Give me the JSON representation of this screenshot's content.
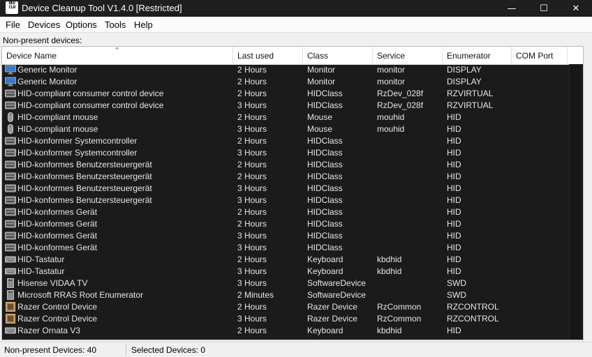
{
  "window": {
    "title": "Device Cleanup Tool V1.4.0  [Restricted]",
    "icon_text": [
      "DEV",
      "CLN"
    ],
    "minimize_glyph": "—",
    "maximize_glyph": "☐",
    "close_glyph": "✕"
  },
  "menu": [
    "File",
    "Devices",
    "Options",
    "Tools",
    "Help"
  ],
  "section_label": "Non-present devices:",
  "columns": [
    "Device Name",
    "Last used",
    "Class",
    "Service",
    "Enumerator",
    "COM Port"
  ],
  "sort_indicator": "⌃",
  "rows": [
    {
      "icon": "monitor-icon",
      "name": "Generic Monitor",
      "last_used": "2 Hours",
      "class": "Monitor",
      "service": "monitor",
      "enumerator": "DISPLAY",
      "com_port": ""
    },
    {
      "icon": "monitor-icon",
      "name": "Generic Monitor",
      "last_used": "2 Hours",
      "class": "Monitor",
      "service": "monitor",
      "enumerator": "DISPLAY",
      "com_port": ""
    },
    {
      "icon": "hid-device-icon",
      "name": "HID-compliant consumer control device",
      "last_used": "2 Hours",
      "class": "HIDClass",
      "service": "RzDev_028f",
      "enumerator": "RZVIRTUAL",
      "com_port": ""
    },
    {
      "icon": "hid-device-icon",
      "name": "HID-compliant consumer control device",
      "last_used": "3 Hours",
      "class": "HIDClass",
      "service": "RzDev_028f",
      "enumerator": "RZVIRTUAL",
      "com_port": ""
    },
    {
      "icon": "mouse-icon",
      "name": "HID-compliant mouse",
      "last_used": "2 Hours",
      "class": "Mouse",
      "service": "mouhid",
      "enumerator": "HID",
      "com_port": ""
    },
    {
      "icon": "mouse-icon",
      "name": "HID-compliant mouse",
      "last_used": "3 Hours",
      "class": "Mouse",
      "service": "mouhid",
      "enumerator": "HID",
      "com_port": ""
    },
    {
      "icon": "hid-device-icon",
      "name": "HID-konformer Systemcontroller",
      "last_used": "2 Hours",
      "class": "HIDClass",
      "service": "",
      "enumerator": "HID",
      "com_port": ""
    },
    {
      "icon": "hid-device-icon",
      "name": "HID-konformer Systemcontroller",
      "last_used": "3 Hours",
      "class": "HIDClass",
      "service": "",
      "enumerator": "HID",
      "com_port": ""
    },
    {
      "icon": "hid-device-icon",
      "name": "HID-konformes Benutzersteuergerät",
      "last_used": "2 Hours",
      "class": "HIDClass",
      "service": "",
      "enumerator": "HID",
      "com_port": ""
    },
    {
      "icon": "hid-device-icon",
      "name": "HID-konformes Benutzersteuergerät",
      "last_used": "2 Hours",
      "class": "HIDClass",
      "service": "",
      "enumerator": "HID",
      "com_port": ""
    },
    {
      "icon": "hid-device-icon",
      "name": "HID-konformes Benutzersteuergerät",
      "last_used": "3 Hours",
      "class": "HIDClass",
      "service": "",
      "enumerator": "HID",
      "com_port": ""
    },
    {
      "icon": "hid-device-icon",
      "name": "HID-konformes Benutzersteuergerät",
      "last_used": "3 Hours",
      "class": "HIDClass",
      "service": "",
      "enumerator": "HID",
      "com_port": ""
    },
    {
      "icon": "hid-device-icon",
      "name": "HID-konformes Gerät",
      "last_used": "2 Hours",
      "class": "HIDClass",
      "service": "",
      "enumerator": "HID",
      "com_port": ""
    },
    {
      "icon": "hid-device-icon",
      "name": "HID-konformes Gerät",
      "last_used": "2 Hours",
      "class": "HIDClass",
      "service": "",
      "enumerator": "HID",
      "com_port": ""
    },
    {
      "icon": "hid-device-icon",
      "name": "HID-konformes Gerät",
      "last_used": "3 Hours",
      "class": "HIDClass",
      "service": "",
      "enumerator": "HID",
      "com_port": ""
    },
    {
      "icon": "hid-device-icon",
      "name": "HID-konformes Gerät",
      "last_used": "3 Hours",
      "class": "HIDClass",
      "service": "",
      "enumerator": "HID",
      "com_port": ""
    },
    {
      "icon": "keyboard-icon",
      "name": "HID-Tastatur",
      "last_used": "2 Hours",
      "class": "Keyboard",
      "service": "kbdhid",
      "enumerator": "HID",
      "com_port": ""
    },
    {
      "icon": "keyboard-icon",
      "name": "HID-Tastatur",
      "last_used": "3 Hours",
      "class": "Keyboard",
      "service": "kbdhid",
      "enumerator": "HID",
      "com_port": ""
    },
    {
      "icon": "software-device-icon",
      "name": "Hisense VIDAA TV",
      "last_used": "3 Hours",
      "class": "SoftwareDevice",
      "service": "",
      "enumerator": "SWD",
      "com_port": ""
    },
    {
      "icon": "software-device-icon",
      "name": "Microsoft RRAS Root Enumerator",
      "last_used": "2 Minutes",
      "class": "SoftwareDevice",
      "service": "",
      "enumerator": "SWD",
      "com_port": ""
    },
    {
      "icon": "razer-device-icon",
      "name": "Razer Control Device",
      "last_used": "2 Hours",
      "class": "Razer Device",
      "service": "RzCommon",
      "enumerator": "RZCONTROL",
      "com_port": ""
    },
    {
      "icon": "razer-device-icon",
      "name": "Razer Control Device",
      "last_used": "3 Hours",
      "class": "Razer Device",
      "service": "RzCommon",
      "enumerator": "RZCONTROL",
      "com_port": ""
    },
    {
      "icon": "keyboard-icon",
      "name": "Razer Ornata V3",
      "last_used": "2 Hours",
      "class": "Keyboard",
      "service": "kbdhid",
      "enumerator": "HID",
      "com_port": ""
    }
  ],
  "status": {
    "left": "Non-present Devices: 40",
    "right": "Selected Devices: 0"
  }
}
